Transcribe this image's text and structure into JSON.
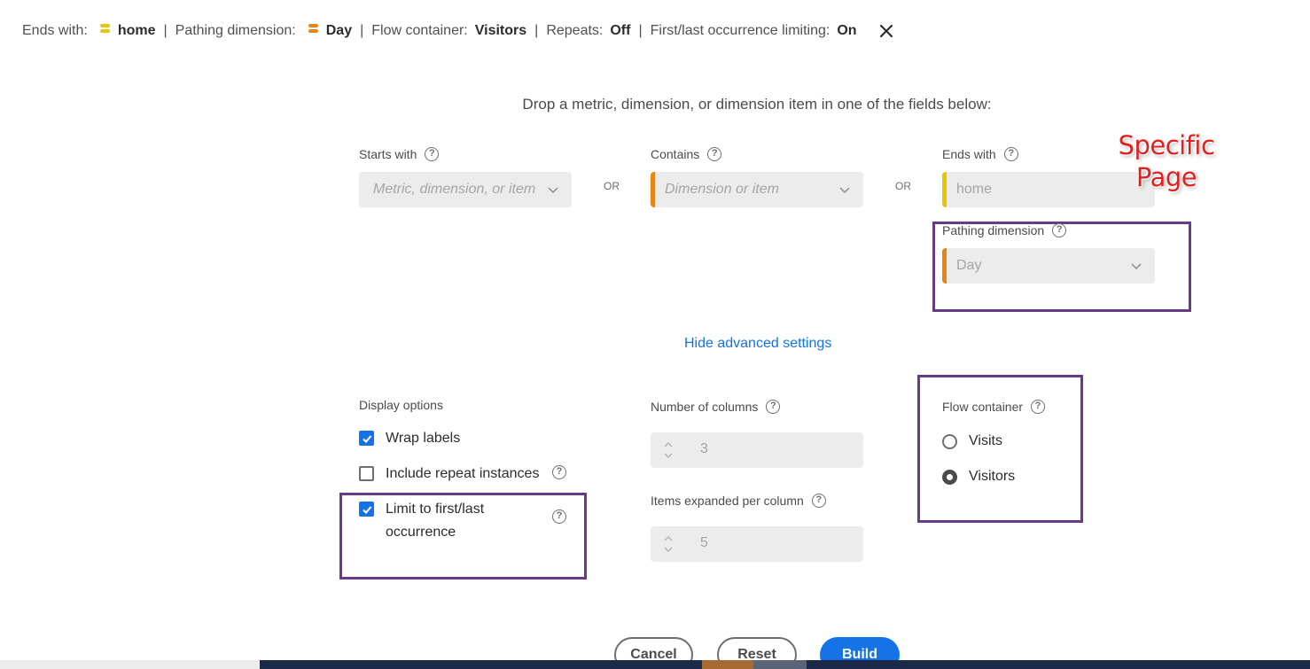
{
  "summary": {
    "ends_with_label": "Ends with:",
    "ends_with_value": "home",
    "pathing_dimension_label": "Pathing dimension:",
    "pathing_dimension_value": "Day",
    "flow_container_label": "Flow container:",
    "flow_container_value": "Visitors",
    "repeats_label": "Repeats:",
    "repeats_value": "Off",
    "limiting_label": "First/last occurrence limiting:",
    "limiting_value": "On",
    "separator": "|",
    "close_icon": "close-icon"
  },
  "instruction": "Drop a metric, dimension, or dimension item in one of the fields below:",
  "fields": {
    "starts_with_label": "Starts with",
    "starts_with_placeholder": "Metric, dimension, or item",
    "or_1": "OR",
    "contains_label": "Contains",
    "contains_placeholder": "Dimension or item",
    "or_2": "OR",
    "ends_with_label": "Ends with",
    "ends_with_value": "home",
    "pathing_dimension_label": "Pathing dimension",
    "pathing_dimension_value": "Day"
  },
  "annotation": {
    "line1": "Specific",
    "line2": "Page"
  },
  "advanced_link": "Hide advanced settings",
  "display_options": {
    "title": "Display options",
    "wrap_labels": "Wrap labels",
    "wrap_labels_checked": true,
    "include_repeat": "Include repeat instances",
    "include_repeat_checked": false,
    "limit_first_last": "Limit to first/last",
    "limit_first_last_2": "occurrence",
    "limit_checked": true
  },
  "columns": {
    "number_label": "Number of columns",
    "number_value": "3",
    "items_label": "Items expanded per column",
    "items_value": "5"
  },
  "flow_container": {
    "title": "Flow container",
    "options": [
      "Visits",
      "Visitors"
    ],
    "selected": "Visitors"
  },
  "buttons": {
    "cancel": "Cancel",
    "reset": "Reset",
    "build": "Build"
  },
  "colors": {
    "accent": "#1473e6",
    "dimension_orange": "#e68619",
    "item_yellow": "#e8c600",
    "annotation_box": "#6a3a8a",
    "annotation_text": "#e01f1f"
  }
}
